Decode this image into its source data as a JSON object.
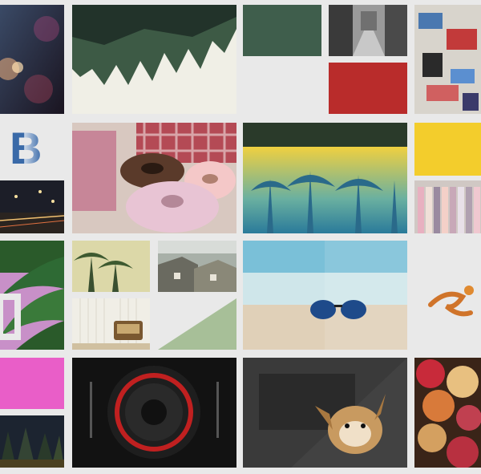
{
  "background": "#e9e9e9",
  "colors": {
    "dark_green_block": "#3f5e4c",
    "red_block": "#b92c2b",
    "yellow_block": "#f3cd2c",
    "magenta_block": "#e95ec8",
    "sage_triangle": "#a7bf98"
  },
  "logo": {
    "letter": "B"
  },
  "tiles": [
    "bokeh-lights",
    "inverted-forest",
    "dark-green-block",
    "street-scene",
    "red-block",
    "graffiti-wall",
    "logo-b",
    "night-city-traffic",
    "donuts",
    "pool-palms",
    "yellow-block",
    "clothes-rack",
    "palm-leaves",
    "palm-trees-sky",
    "rooftops",
    "sunglasses-beach",
    "paint-splash",
    "retro-radio",
    "sage-triangle",
    "magenta-block",
    "dark-forest",
    "speaker",
    "dog-in-car",
    "flowers"
  ]
}
